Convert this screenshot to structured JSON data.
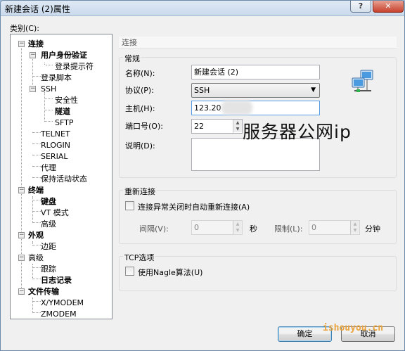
{
  "window": {
    "title": "新建会话 (2)属性",
    "help_btn": "?",
    "close_btn": "✕"
  },
  "category_label": "类别(C):",
  "tree": [
    {
      "label": "连接",
      "bold": true
    },
    {
      "label": "用户身份验证",
      "bold": true
    },
    {
      "label": "登录提示符",
      "bold": false
    },
    {
      "label": "登录脚本",
      "bold": false
    },
    {
      "label": "SSH",
      "bold": false
    },
    {
      "label": "安全性",
      "bold": false
    },
    {
      "label": "隧道",
      "bold": true
    },
    {
      "label": "SFTP",
      "bold": false
    },
    {
      "label": "TELNET",
      "bold": false
    },
    {
      "label": "RLOGIN",
      "bold": false
    },
    {
      "label": "SERIAL",
      "bold": false
    },
    {
      "label": "代理",
      "bold": false
    },
    {
      "label": "保持活动状态",
      "bold": false
    },
    {
      "label": "终端",
      "bold": true
    },
    {
      "label": "键盘",
      "bold": true
    },
    {
      "label": "VT 模式",
      "bold": false
    },
    {
      "label": "高级",
      "bold": false
    },
    {
      "label": "外观",
      "bold": true
    },
    {
      "label": "边距",
      "bold": false
    },
    {
      "label": "高级",
      "bold": false
    },
    {
      "label": "跟踪",
      "bold": false
    },
    {
      "label": "日志记录",
      "bold": true
    },
    {
      "label": "文件传输",
      "bold": true
    },
    {
      "label": "X/YMODEM",
      "bold": false
    },
    {
      "label": "ZMODEM",
      "bold": false
    }
  ],
  "section_header": "连接",
  "general": {
    "title": "常规",
    "name_label": "名称(N):",
    "name_value": "新建会话 (2)",
    "protocol_label": "协议(P):",
    "protocol_value": "SSH",
    "host_label": "主机(H):",
    "host_value": "123.20",
    "port_label": "端口号(O):",
    "port_value": "22",
    "desc_label": "说明(D):",
    "desc_value": ""
  },
  "reconnect": {
    "title": "重新连接",
    "auto_reconnect_label": "连接异常关闭时自动重新连接(A)",
    "interval_label": "间隔(V):",
    "interval_value": "0",
    "interval_unit": "秒",
    "limit_label": "限制(L):",
    "limit_value": "0",
    "limit_unit": "分钟"
  },
  "tcp": {
    "title": "TCP选项",
    "nagle_label": "使用Nagle算法(U)"
  },
  "buttons": {
    "ok": "确定",
    "cancel": "取消"
  },
  "watermark_text": "服务器公网ip",
  "watermark_site": "ishouyou.cn"
}
